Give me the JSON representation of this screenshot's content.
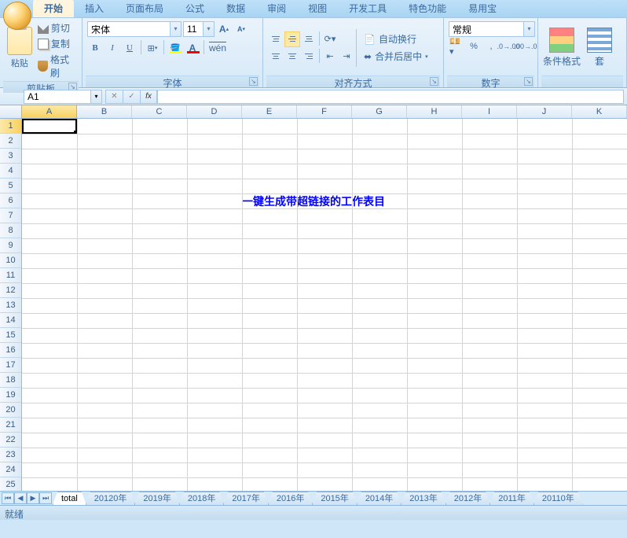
{
  "tabs": {
    "active": "开始",
    "items": [
      "开始",
      "插入",
      "页面布局",
      "公式",
      "数据",
      "审阅",
      "视图",
      "开发工具",
      "特色功能",
      "易用宝"
    ]
  },
  "clipboard": {
    "title": "剪贴板",
    "paste": "粘贴",
    "cut": "剪切",
    "copy": "复制",
    "brush": "格式刷"
  },
  "font": {
    "title": "字体",
    "name": "宋体",
    "size": "11",
    "bold": "B",
    "italic": "I",
    "underline": "U"
  },
  "align": {
    "title": "对齐方式",
    "wrap": "自动换行",
    "merge": "合并后居中"
  },
  "number": {
    "title": "数字",
    "format": "常规"
  },
  "style": {
    "cond": "条件格式",
    "tbl": "套"
  },
  "namebox": "A1",
  "content": "一键生成带超链接的工作表目",
  "columns": [
    "A",
    "B",
    "C",
    "D",
    "E",
    "F",
    "G",
    "H",
    "I",
    "J",
    "K"
  ],
  "rows": [
    "1",
    "2",
    "3",
    "4",
    "5",
    "6",
    "7",
    "8",
    "9",
    "10",
    "11",
    "12",
    "13",
    "14",
    "15",
    "16",
    "17",
    "18",
    "19",
    "20",
    "21",
    "22",
    "23",
    "24",
    "25"
  ],
  "sheets": [
    "total",
    "20120年",
    "2019年",
    "2018年",
    "2017年",
    "2016年",
    "2015年",
    "2014年",
    "2013年",
    "2012年",
    "2011年",
    "20110年"
  ],
  "status": "就绪"
}
